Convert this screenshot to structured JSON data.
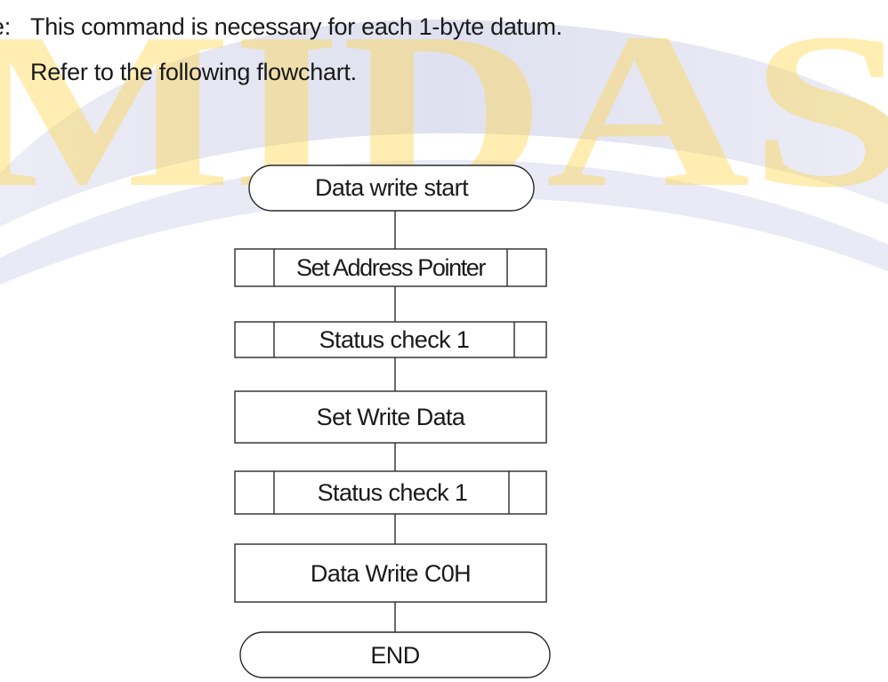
{
  "watermark": {
    "text": "MIDAS",
    "colors": {
      "swoosh": "#c9cbe4",
      "letters": "#ffd64a"
    }
  },
  "note": {
    "prefix": "e:",
    "line1": "This command is necessary for each 1-byte datum.",
    "line2": "Refer to the following flowchart."
  },
  "flowchart": {
    "nodes": [
      {
        "id": "start",
        "shape": "terminator",
        "label": "Data write start"
      },
      {
        "id": "set-address-pointer",
        "shape": "predefined-process",
        "label": "Set Address Pointer"
      },
      {
        "id": "status-check-1a",
        "shape": "predefined-process",
        "label": "Status check 1"
      },
      {
        "id": "set-write-data",
        "shape": "process",
        "label": "Set Write Data"
      },
      {
        "id": "status-check-1b",
        "shape": "predefined-process",
        "label": "Status check 1"
      },
      {
        "id": "data-write-c0h",
        "shape": "process",
        "label": "Data Write C0H"
      },
      {
        "id": "end",
        "shape": "terminator",
        "label": "END"
      }
    ],
    "colors": {
      "stroke": "#2a2a2a",
      "fill": "#ffffff"
    }
  }
}
